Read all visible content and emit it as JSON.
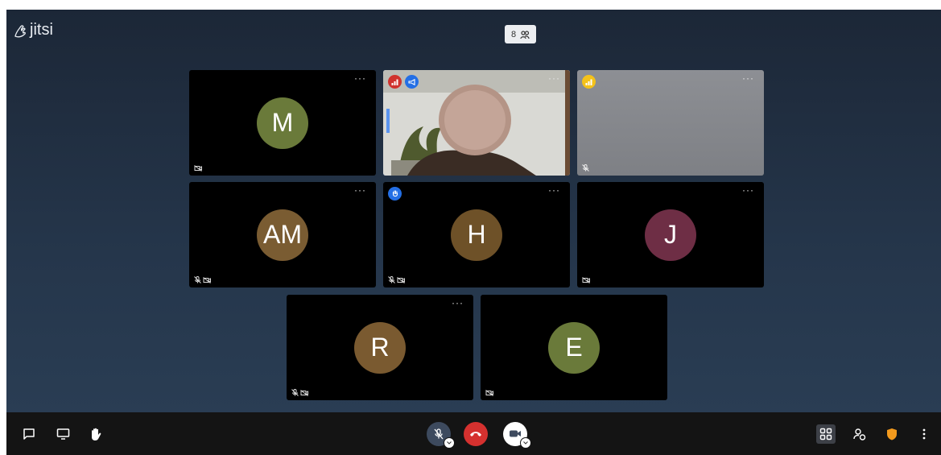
{
  "app": {
    "logo_text": "jitsi",
    "logo_icon": "jitsi-hand-logo"
  },
  "header": {
    "participant_count": "8",
    "count_icon": "participants-icon"
  },
  "participants": [
    {
      "initials": "M",
      "color": "#6a7a3a",
      "indicators": [],
      "status": [
        "camera-off-icon"
      ]
    },
    {
      "initials": "",
      "video": true,
      "indicators": [
        "connection-red-icon",
        "dominant-speaker-icon"
      ],
      "status": []
    },
    {
      "initials": "",
      "video_gray": true,
      "indicators": [
        "connection-yellow-icon"
      ],
      "status": [
        "mic-muted-icon"
      ]
    },
    {
      "initials": "AM",
      "color": "#7a5c32",
      "indicators": [],
      "status": [
        "mic-muted-icon",
        "camera-off-icon"
      ]
    },
    {
      "initials": "H",
      "color": "#6e5128",
      "indicators": [
        "raised-hand-icon"
      ],
      "status": [
        "mic-muted-icon",
        "camera-off-icon"
      ]
    },
    {
      "initials": "J",
      "color": "#6e2e45",
      "indicators": [],
      "status": [
        "camera-off-icon"
      ]
    },
    {
      "initials": "R",
      "color": "#7a5a30",
      "indicators": [],
      "status": [
        "mic-muted-icon",
        "camera-off-icon"
      ]
    },
    {
      "initials": "E",
      "color": "#6a7a3a",
      "indicators": [],
      "status": [
        "camera-off-icon"
      ]
    }
  ],
  "tile_menu_glyph": "···",
  "toolbar": {
    "left": [
      "chat-icon",
      "screenshare-icon",
      "raise-hand-icon"
    ],
    "center": [
      "microphone-muted-icon",
      "hangup-icon",
      "camera-icon"
    ],
    "right": [
      "tile-view-icon",
      "invite-people-icon",
      "security-shield-icon",
      "more-options-icon"
    ],
    "hangup_color": "#d5312f",
    "shield_color": "#f39a1d"
  }
}
